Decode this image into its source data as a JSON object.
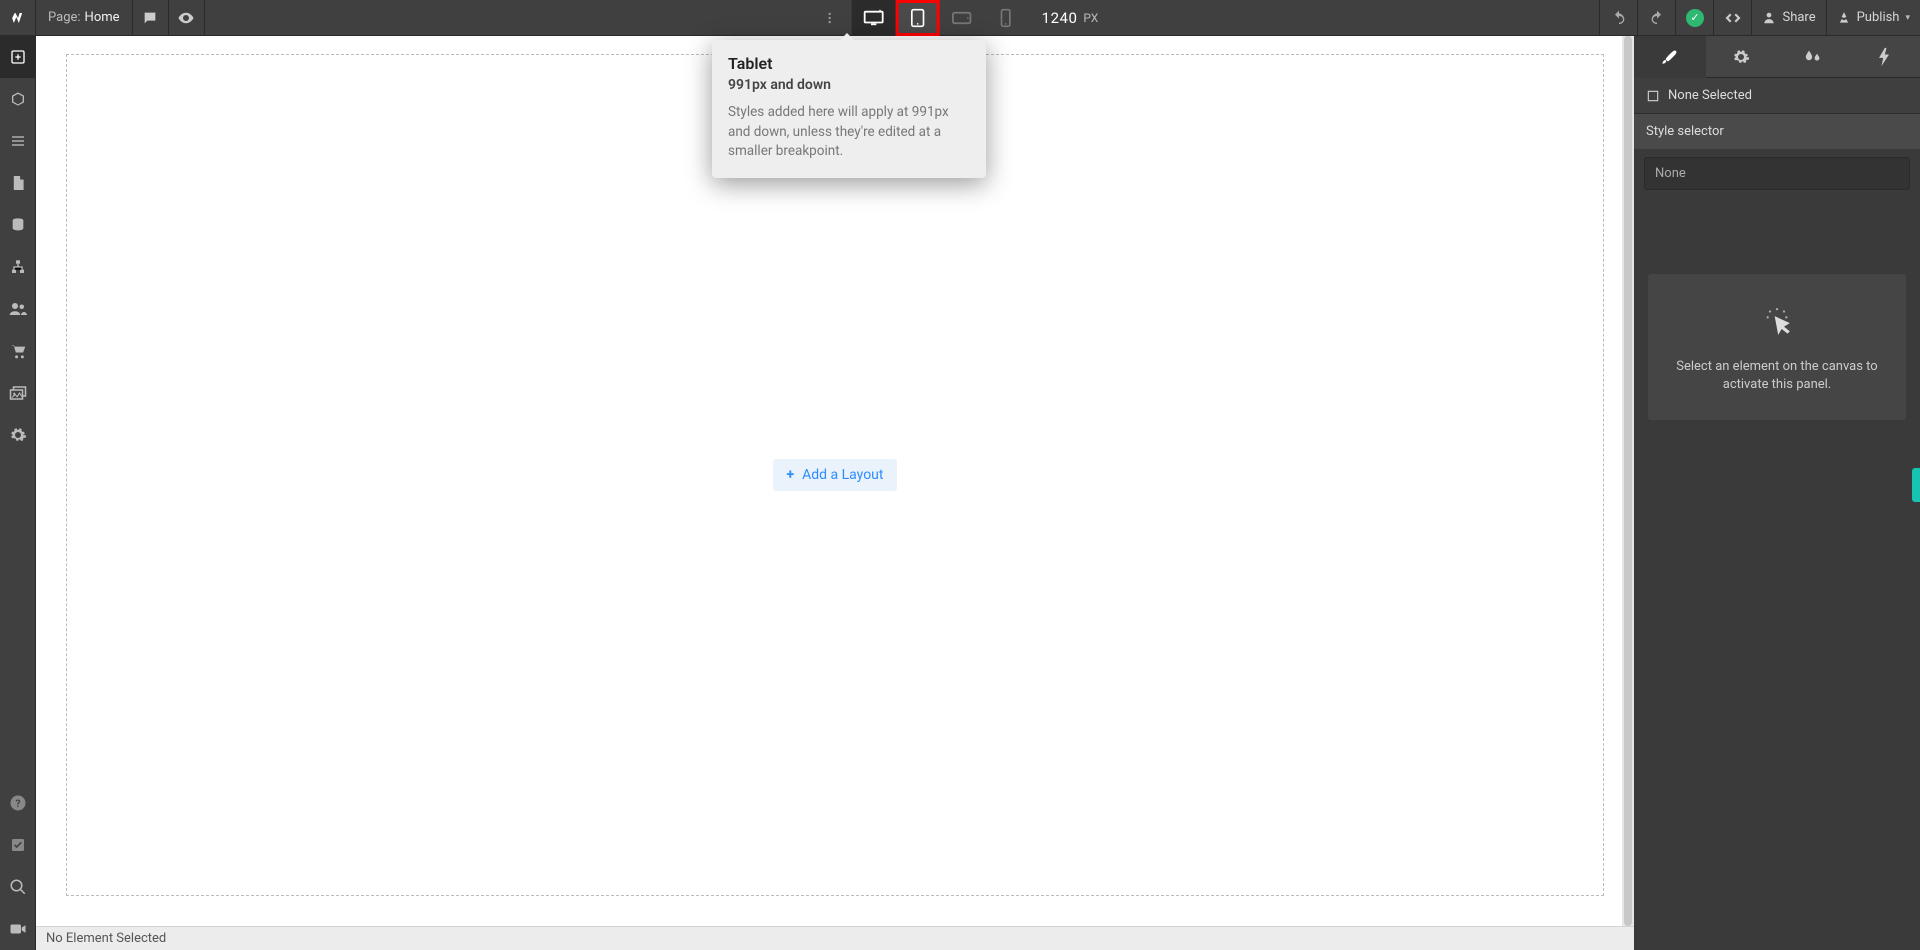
{
  "topbar": {
    "page_label": "Page:",
    "page_name": "Home",
    "size_value": "1240",
    "size_unit": "PX",
    "share_label": "Share",
    "publish_label": "Publish"
  },
  "tooltip": {
    "title": "Tablet",
    "subtitle": "991px and down",
    "body": "Styles added here will apply at 991px and down, unless they're edited at a smaller breakpoint."
  },
  "canvas": {
    "add_layout_label": "Add a Layout"
  },
  "bottom": {
    "status": "No Element Selected"
  },
  "right_panel": {
    "none_selected": "None Selected",
    "style_selector_label": "Style selector",
    "style_input_placeholder": "None",
    "empty_text": "Select an element on the canvas to activate this panel."
  }
}
